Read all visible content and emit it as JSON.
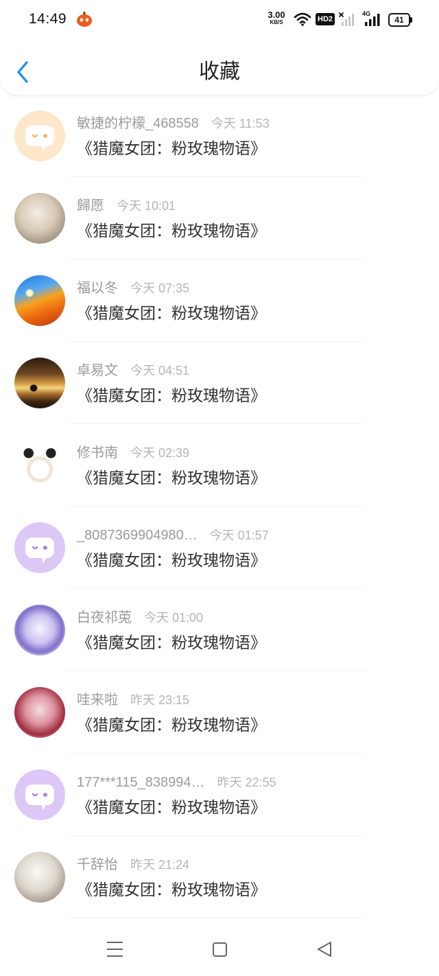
{
  "status_bar": {
    "time": "14:49",
    "app_icon": "pumpkin-app-icon",
    "net_speed": "3.00",
    "net_speed_unit": "KB/S",
    "hd_label": "HD2",
    "network_type": "4G",
    "battery": "41"
  },
  "header": {
    "title": "收藏",
    "back_icon": "chevron-left-icon",
    "accent": "#2b8ff0"
  },
  "items": [
    {
      "name": "敏捷的柠檬_468558",
      "time": "今天 11:53",
      "title": "《猎魔女团：粉玫瑰物语》",
      "avatar": "default",
      "avatar_bg": "#fde8cc",
      "avatar_accent": "#f3b56b"
    },
    {
      "name": "歸愿",
      "time": "今天 10:01",
      "title": "《猎魔女团：粉玫瑰物语》",
      "avatar": "photo"
    },
    {
      "name": "福以冬",
      "time": "今天 07:35",
      "title": "《猎魔女团：粉玫瑰物语》",
      "avatar": "photo"
    },
    {
      "name": "卓易文",
      "time": "今天 04:51",
      "title": "《猎魔女团：粉玫瑰物语》",
      "avatar": "photo"
    },
    {
      "name": "修书南",
      "time": "今天 02:39",
      "title": "《猎魔女团：粉玫瑰物语》",
      "avatar": "photo"
    },
    {
      "name": "_8087369904980…",
      "time": "今天 01:57",
      "title": "《猎魔女团：粉玫瑰物语》",
      "avatar": "default",
      "avatar_bg": "#dcc7f7",
      "avatar_accent": "#a985ea"
    },
    {
      "name": "白夜祁莵",
      "time": "今天 01:00",
      "title": "《猎魔女团：粉玫瑰物语》",
      "avatar": "photo"
    },
    {
      "name": "哇来啦",
      "time": "昨天 23:15",
      "title": "《猎魔女团：粉玫瑰物语》",
      "avatar": "photo"
    },
    {
      "name": "177***115_838994…",
      "time": "昨天 22:55",
      "title": "《猎魔女团：粉玫瑰物语》",
      "avatar": "default",
      "avatar_bg": "#dcc7f7",
      "avatar_accent": "#a985ea"
    },
    {
      "name": "千辞怡",
      "time": "昨天 21:24",
      "title": "《猎魔女团：粉玫瑰物语》",
      "avatar": "photo"
    }
  ],
  "nav": {
    "menu_icon": "menu-icon",
    "home_icon": "home-square-icon",
    "back_icon": "back-triangle-icon"
  }
}
